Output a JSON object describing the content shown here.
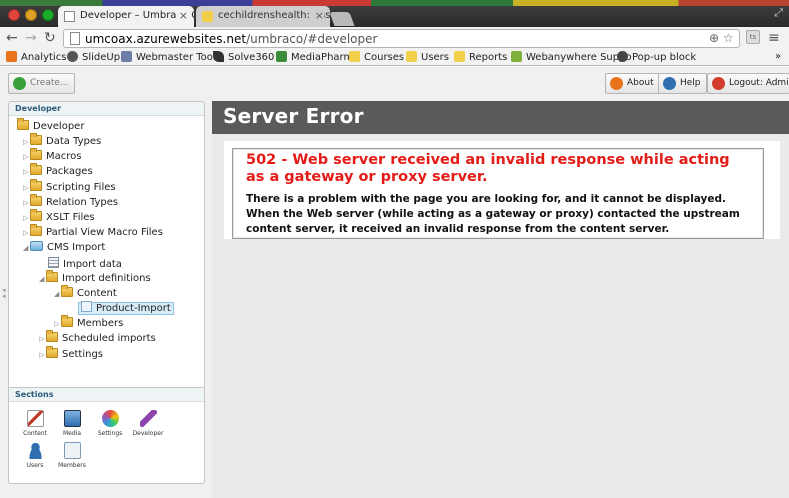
{
  "browser": {
    "tabs": [
      {
        "title": "Developer – Umbraco CMS",
        "close": "×"
      },
      {
        "title": "cechildrenshealth: Assessi",
        "close": "×"
      }
    ],
    "url_domain": "umcoax.azurewebsites.net",
    "url_path": "/umbraco/#developer",
    "back": "←",
    "forward": "→",
    "reload": "↻",
    "zoom_icon": "⊕",
    "star_icon": "☆",
    "menu_icon": "≡",
    "overflow": "»",
    "bookmarks": [
      {
        "label": "Analytics",
        "color": "#e8731b"
      },
      {
        "label": "SlideUp",
        "color": "#555555"
      },
      {
        "label": "Webmaster Tools",
        "color": "#6d7fa8"
      },
      {
        "label": "Solve360",
        "color": "#333333"
      },
      {
        "label": "MediaPharm",
        "color": "#3c8d3a"
      },
      {
        "label": "Courses",
        "color": "#f2cf4a"
      },
      {
        "label": "Users",
        "color": "#f2cf4a"
      },
      {
        "label": "Reports",
        "color": "#f2cf4a"
      },
      {
        "label": "Webanywhere Suppo",
        "color": "#7fb03a"
      },
      {
        "label": "Pop-up block",
        "color": "#444444"
      }
    ]
  },
  "topbar": {
    "create": "Create...",
    "about": "About",
    "help": "Help",
    "logout": "Logout: Admin"
  },
  "tree": {
    "title": "Developer",
    "root": "Developer",
    "items": {
      "data_types": "Data Types",
      "macros": "Macros",
      "packages": "Packages",
      "scripting_files": "Scripting Files",
      "relation_types": "Relation Types",
      "xslt_files": "XSLT Files",
      "partial_view_macro_files": "Partial View Macro Files",
      "cms_import": "CMS Import",
      "import_data": "Import data",
      "import_definitions": "Import definitions",
      "content": "Content",
      "product_import": "Product-Import",
      "members": "Members",
      "scheduled_imports": "Scheduled imports",
      "settings": "Settings"
    }
  },
  "sections": {
    "title": "Sections",
    "items": [
      {
        "label": "Content",
        "icon": "content-icon",
        "color": "#c0392b"
      },
      {
        "label": "Media",
        "icon": "media-icon",
        "color": "#3b78b8"
      },
      {
        "label": "Settings",
        "icon": "settings-icon",
        "color": "#e0a020"
      },
      {
        "label": "Developer",
        "icon": "developer-icon",
        "color": "#8e44ad"
      },
      {
        "label": "Users",
        "icon": "users-icon",
        "color": "#2f6fb0"
      },
      {
        "label": "Members",
        "icon": "members-icon",
        "color": "#7a9ab8"
      }
    ]
  },
  "content": {
    "header": "Server Error",
    "error_title": "502 - Web server received an invalid response while acting as a gateway or proxy server.",
    "error_text": "There is a problem with the page you are looking for, and it cannot be displayed. When the Web server (while acting as a gateway or proxy) contacted the upstream content server, it received an invalid response from the content server."
  },
  "colors": {
    "error_red": "#e41b17",
    "header_gray": "#5a5a5a",
    "selection": "#d7ebf8"
  }
}
